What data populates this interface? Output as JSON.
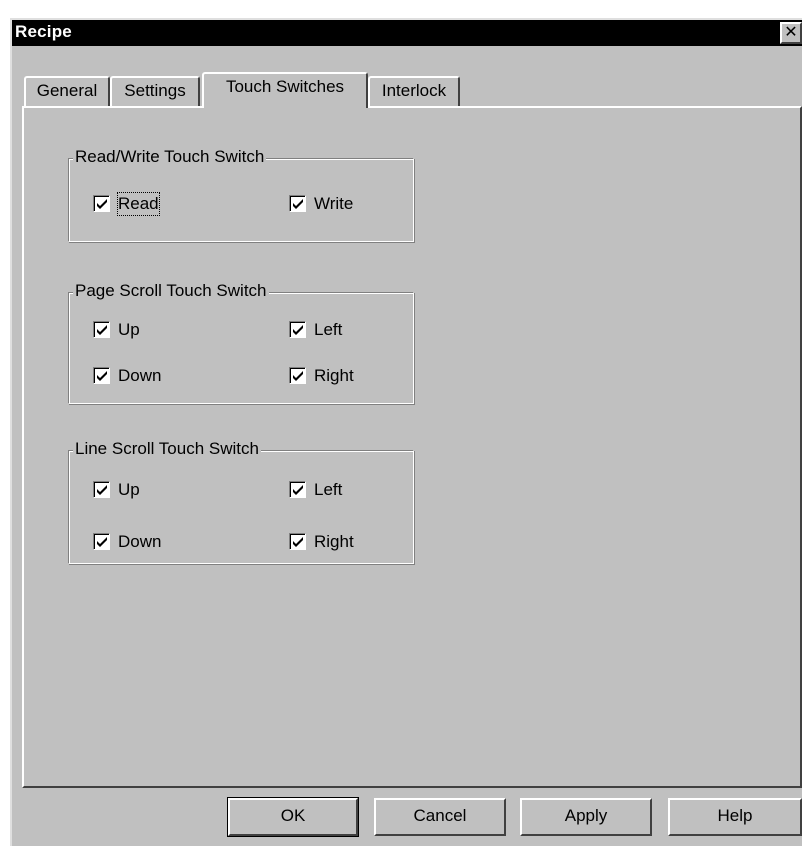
{
  "window": {
    "title": "Recipe",
    "close_glyph": "✕"
  },
  "tabs": [
    {
      "label": "General"
    },
    {
      "label": "Settings"
    },
    {
      "label": "Touch Switches"
    },
    {
      "label": "Interlock"
    }
  ],
  "groups": {
    "read_write": {
      "label": "Read/Write Touch Switch",
      "read": {
        "label": "Read",
        "checked": true
      },
      "write": {
        "label": "Write",
        "checked": true
      }
    },
    "page_scroll": {
      "label": "Page Scroll Touch Switch",
      "up": {
        "label": "Up",
        "checked": true
      },
      "left": {
        "label": "Left",
        "checked": true
      },
      "down": {
        "label": "Down",
        "checked": true
      },
      "right": {
        "label": "Right",
        "checked": true
      }
    },
    "line_scroll": {
      "label": "Line Scroll Touch Switch",
      "up": {
        "label": "Up",
        "checked": true
      },
      "left": {
        "label": "Left",
        "checked": true
      },
      "down": {
        "label": "Down",
        "checked": true
      },
      "right": {
        "label": "Right",
        "checked": true
      }
    }
  },
  "buttons": {
    "ok": "OK",
    "cancel": "Cancel",
    "apply": "Apply",
    "help": "Help"
  },
  "colors": {
    "face": "#c0c0c0",
    "titlebar": "#000000",
    "highlight": "#ffffff",
    "shadow": "#808080"
  }
}
